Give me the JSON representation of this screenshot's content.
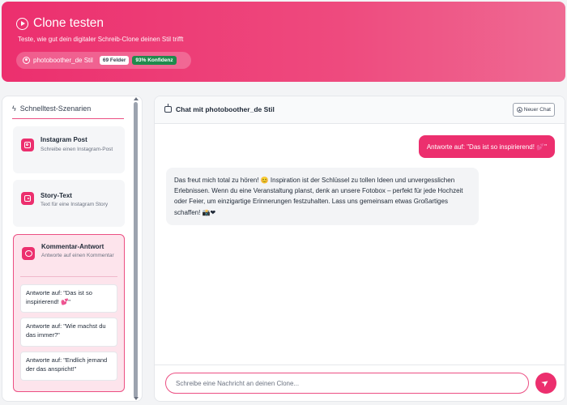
{
  "header": {
    "title": "Clone testen",
    "subtitle": "Teste, wie gut dein digitaler Schreib-Clone deinen Stil trifft",
    "style_label": "photoboother_de Stil",
    "fields_badge": "69 Felder",
    "confidence_badge": "93% Konfidenz"
  },
  "sidebar": {
    "title": "Schnelltest-Szenarien",
    "cards": [
      {
        "title": "Instagram Post",
        "desc": "Schreibe einen Instagram-Post",
        "icon": "instagram-icon"
      },
      {
        "title": "Story-Text",
        "desc": "Text für eine Instagram Story",
        "icon": "story-icon"
      },
      {
        "title": "Kommentar-Antwort",
        "desc": "Antworte auf einen Kommentar",
        "icon": "comment-icon",
        "sub_items": [
          "Antworte auf: \"Das ist so inspirierend! 💕\"",
          "Antworte auf: \"Wie machst du das immer?\"",
          "Antworte auf: \"Endlich jemand der das anspricht!\""
        ]
      }
    ]
  },
  "chat": {
    "title": "Chat mit photoboother_de Stil",
    "new_chat_label": "Neuer Chat",
    "messages": [
      {
        "role": "user",
        "text": "Antworte auf: \"Das ist so inspirierend! 💕\""
      },
      {
        "role": "bot",
        "text": "Das freut mich total zu hören! 😊 Inspiration ist der Schlüssel zu tollen Ideen und unvergesslichen Erlebnissen. Wenn du eine Veranstaltung planst, denk an unsere Fotobox – perfekt für jede Hochzeit oder Feier, um einzigartige Erinnerungen festzuhalten. Lass uns gemeinsam etwas Großartiges schaffen! 📸❤"
      }
    ],
    "input_placeholder": "Schreibe eine Nachricht an deinen Clone...",
    "input_value": ""
  },
  "colors": {
    "accent": "#ec2f6e",
    "confidence_badge": "#1f8a4c"
  }
}
